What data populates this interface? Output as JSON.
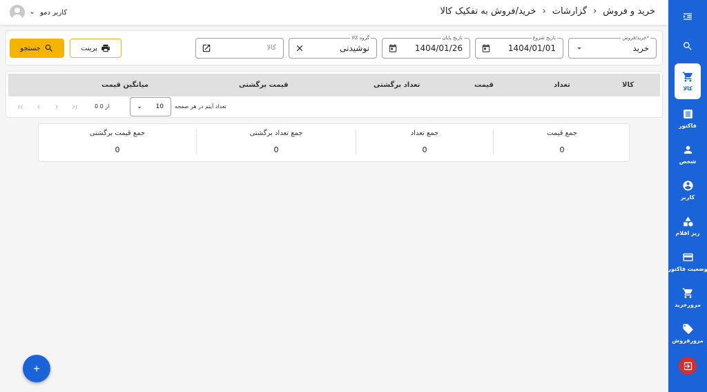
{
  "header": {
    "breadcrumbs": [
      "خرید و فروش",
      "گزارشات",
      "خرید/فروش به تفکیک کالا"
    ],
    "user_name": "کاربر دمو"
  },
  "sidebar": {
    "items": [
      {
        "label": "کالا",
        "icon": "cart-icon",
        "active": true
      },
      {
        "label": "فاکتور",
        "icon": "invoice-icon",
        "active": false
      },
      {
        "label": "شخص",
        "icon": "person-icon",
        "active": false
      },
      {
        "label": "کاربر",
        "icon": "account-circle-icon",
        "active": false
      },
      {
        "label": "ریز اقلام",
        "icon": "shapes-icon",
        "active": false
      },
      {
        "label": "وضعیت فاکتور",
        "icon": "credit-card-icon",
        "active": false
      },
      {
        "label": "مرورخرید",
        "icon": "cart-icon",
        "active": false
      },
      {
        "label": "مرورفروش",
        "icon": "tag-icon",
        "active": false
      }
    ]
  },
  "filters": {
    "type": {
      "label": "خرید/فروش*",
      "value": "خرید"
    },
    "start_date": {
      "label": "تاریخ شروع",
      "value": "1404/01/01"
    },
    "end_date": {
      "label": "تاریخ پایان",
      "value": "1404/01/26"
    },
    "group": {
      "label": "گروه کالا",
      "value": "نوشیدنی"
    },
    "product": {
      "placeholder": "کالا"
    },
    "print_label": "پرینت",
    "search_label": "جستجو"
  },
  "table": {
    "columns": [
      "کالا",
      "تعداد",
      "قیمت",
      "تعداد برگشتی",
      "قیمت برگشتی",
      "میانگین قیمت"
    ],
    "rows": [],
    "pager": {
      "rows_per_page_label": "تعداد آیتم در هر صفحه",
      "rows_per_page": "10",
      "range": "0 از 0"
    }
  },
  "summary": [
    {
      "title": "جمع قیمت",
      "value": "0"
    },
    {
      "title": "جمع تعداد",
      "value": "0"
    },
    {
      "title": "جمع تعداد برگشتی",
      "value": "0"
    },
    {
      "title": "جمع قیمت برگشتی",
      "value": "0"
    }
  ],
  "colors": {
    "primary": "#1a63d8",
    "accent": "#f4b400",
    "logout": "#d32f2f"
  }
}
